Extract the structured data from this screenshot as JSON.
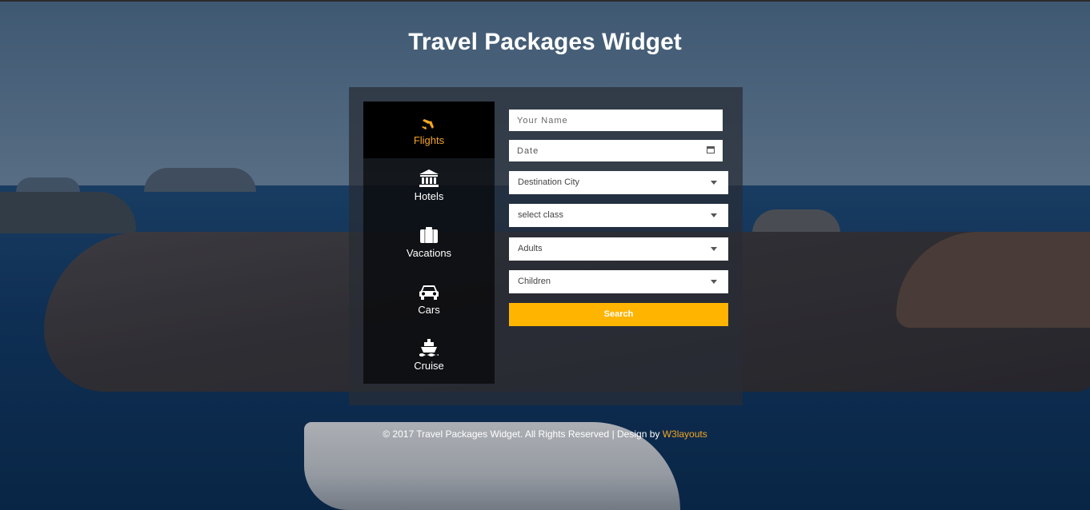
{
  "page": {
    "title": "Travel Packages Widget"
  },
  "tabs": [
    {
      "label": "Flights",
      "icon": "plane-icon",
      "active": true
    },
    {
      "label": "Hotels",
      "icon": "bank-icon",
      "active": false
    },
    {
      "label": "Vacations",
      "icon": "suitcase-icon",
      "active": false
    },
    {
      "label": "Cars",
      "icon": "car-icon",
      "active": false
    },
    {
      "label": "Cruise",
      "icon": "ship-icon",
      "active": false
    }
  ],
  "form": {
    "name_placeholder": "Your Name",
    "date_placeholder": "Date",
    "destination": "Destination City",
    "class": "select class",
    "adults": "Adults",
    "children": "Children",
    "search_label": "Search"
  },
  "footer": {
    "text": "© 2017 Travel Packages Widget. All Rights Reserved | Design by ",
    "link_label": "W3layouts"
  },
  "colors": {
    "accent": "#f5a623",
    "button": "#ffb400"
  }
}
